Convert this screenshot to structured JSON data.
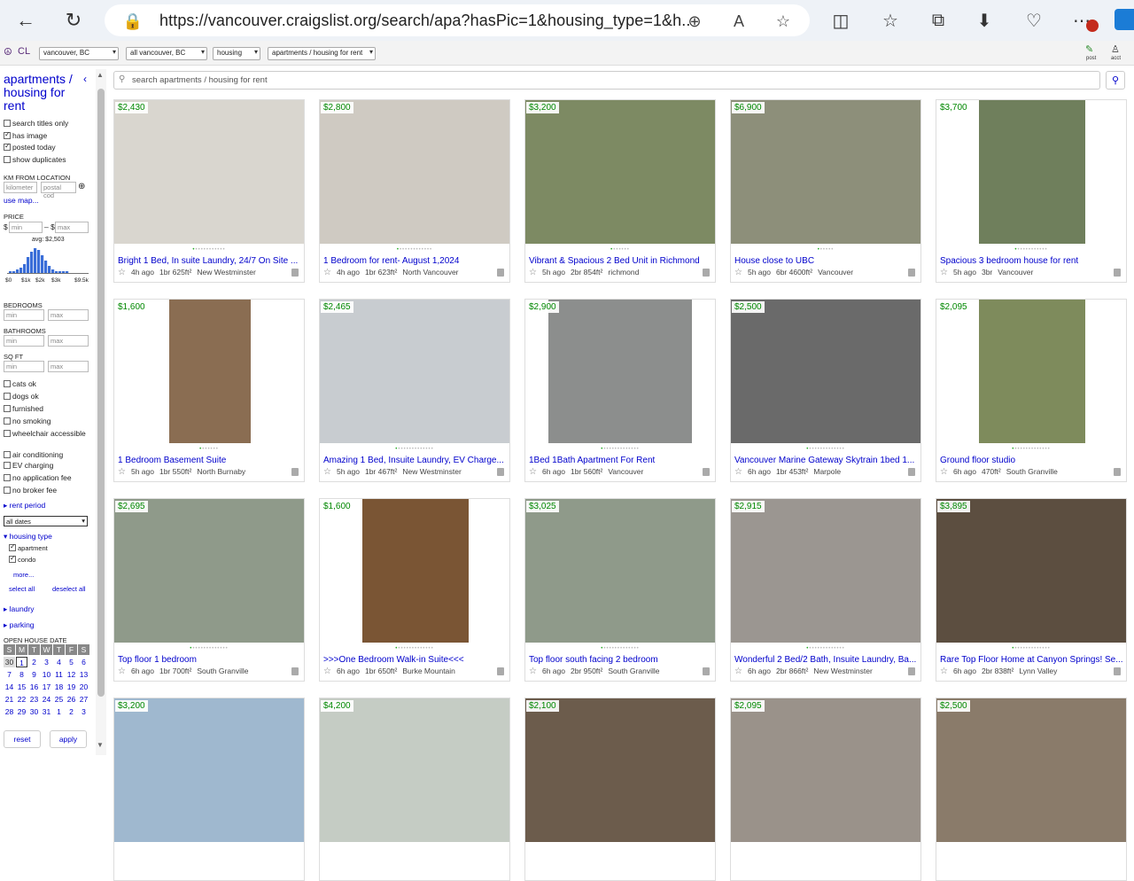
{
  "browser": {
    "url": "https://vancouver.craigslist.org/search/apa?hasPic=1&housing_type=1&h..."
  },
  "topbar": {
    "logo": "CL",
    "selects": [
      "vancouver, BC",
      "all vancouver, BC",
      "housing",
      "apartments / housing for rent"
    ],
    "post_label": "post",
    "acct_label": "acct"
  },
  "sidebar": {
    "title": "apartments / housing for rent",
    "options": [
      {
        "label": "search titles only",
        "checked": false
      },
      {
        "label": "has image",
        "checked": true
      },
      {
        "label": "posted today",
        "checked": true
      },
      {
        "label": "show duplicates",
        "checked": false
      }
    ],
    "km_label": "KM FROM LOCATION",
    "km_placeholder": "kilometer",
    "postal_placeholder": "postal cod",
    "use_map": "use map...",
    "price_label": "PRICE",
    "price_min": "min",
    "price_max": "max",
    "price_avg": "avg: $2,503",
    "hist_ticks": [
      "$0",
      "$1k",
      "$2k",
      "$3k",
      "$9.5k"
    ],
    "bedrooms_label": "BEDROOMS",
    "bathrooms_label": "BATHROOMS",
    "sqft_label": "SQ FT",
    "min": "min",
    "max": "max",
    "amenities": [
      {
        "label": "cats ok"
      },
      {
        "label": "dogs ok"
      },
      {
        "label": "furnished"
      },
      {
        "label": "no smoking"
      },
      {
        "label": "wheelchair accessible"
      },
      {
        "label": "air conditioning"
      },
      {
        "label": "EV charging"
      },
      {
        "label": "no application fee"
      },
      {
        "label": "no broker fee"
      }
    ],
    "rent_period": "rent period",
    "dates_select": "all dates",
    "housing_type": "housing type",
    "housing_options": [
      {
        "label": "apartment",
        "checked": true
      },
      {
        "label": "condo",
        "checked": true
      }
    ],
    "more": "more...",
    "select_all": "select all",
    "deselect_all": "deselect all",
    "laundry": "laundry",
    "parking": "parking",
    "open_house_label": "OPEN HOUSE DATE",
    "calendar_head": [
      "S",
      "M",
      "T",
      "W",
      "T",
      "F",
      "S"
    ],
    "calendar_rows": [
      [
        "30",
        "1",
        "2",
        "3",
        "4",
        "5",
        "6"
      ],
      [
        "7",
        "8",
        "9",
        "10",
        "11",
        "12",
        "13"
      ],
      [
        "14",
        "15",
        "16",
        "17",
        "18",
        "19",
        "20"
      ],
      [
        "21",
        "22",
        "23",
        "24",
        "25",
        "26",
        "27"
      ],
      [
        "28",
        "29",
        "30",
        "31",
        "1",
        "2",
        "3"
      ]
    ],
    "reset": "reset",
    "apply": "apply"
  },
  "search": {
    "placeholder": "search apartments / housing for rent"
  },
  "listings": [
    {
      "price": "$2,430",
      "title": "Bright 1 Bed, In suite Laundry, 24/7 On Site ...",
      "age": "4h ago",
      "size": "1br 625ft²",
      "loc": "New Westminster",
      "dots": 12,
      "active": 0,
      "color": "#d9d6cf"
    },
    {
      "price": "$2,800",
      "title": "1 Bedroom for rent- August 1,2024",
      "age": "4h ago",
      "size": "1br 623ft²",
      "loc": "North Vancouver",
      "dots": 13,
      "active": 0,
      "color": "#cfcac2"
    },
    {
      "price": "$3,200",
      "title": "Vibrant & Spacious 2 Bed Unit in Richmond",
      "age": "5h ago",
      "size": "2br 854ft²",
      "loc": "richmond",
      "dots": 7,
      "active": 0,
      "color": "#7d8a63"
    },
    {
      "price": "$6,900",
      "title": "House close to UBC",
      "age": "5h ago",
      "size": "6br 4600ft²",
      "loc": "Vancouver",
      "dots": 6,
      "active": 0,
      "color": "#8d8f7a"
    },
    {
      "price": "$3,700",
      "title": "Spacious 3 bedroom house for rent",
      "age": "5h ago",
      "size": "3br",
      "loc": "Vancouver",
      "dots": 12,
      "active": 0,
      "color": "#6f7f5c"
    },
    {
      "price": "$1,600",
      "title": "1 Bedroom Basement Suite",
      "age": "5h ago",
      "size": "1br 550ft²",
      "loc": "North Burnaby",
      "dots": 7,
      "active": 0,
      "color": "#8a6d52"
    },
    {
      "price": "$2,465",
      "title": "Amazing 1 Bed, Insuite Laundry, EV Charge...",
      "age": "5h ago",
      "size": "1br 467ft²",
      "loc": "New Westminster",
      "dots": 14,
      "active": 0,
      "color": "#c8ccd0"
    },
    {
      "price": "$2,900",
      "title": "1Bed 1Bath Apartment For Rent",
      "age": "6h ago",
      "size": "1br 560ft²",
      "loc": "Vancouver",
      "dots": 14,
      "active": 0,
      "color": "#8c8e8d"
    },
    {
      "price": "$2,500",
      "title": "Vancouver Marine Gateway Skytrain 1bed 1...",
      "age": "6h ago",
      "size": "1br 453ft²",
      "loc": "Marpole",
      "dots": 14,
      "active": 0,
      "color": "#6a6a6a"
    },
    {
      "price": "$2,095",
      "title": "Ground floor studio",
      "age": "6h ago",
      "size": "470ft²",
      "loc": "South Granville",
      "dots": 14,
      "active": 0,
      "color": "#7e8b5c"
    },
    {
      "price": "$2,695",
      "title": "Top floor 1 bedroom",
      "age": "6h ago",
      "size": "1br 700ft²",
      "loc": "South Granville",
      "dots": 14,
      "active": 0,
      "color": "#8f9a8a"
    },
    {
      "price": "$1,600",
      "title": ">>>One Bedroom Walk-in Suite<<<",
      "age": "6h ago",
      "size": "1br 650ft²",
      "loc": "Burke Mountain",
      "dots": 14,
      "active": 0,
      "color": "#7a5534"
    },
    {
      "price": "$3,025",
      "title": "Top floor south facing 2 bedroom",
      "age": "6h ago",
      "size": "2br 950ft²",
      "loc": "South Granville",
      "dots": 14,
      "active": 0,
      "color": "#8f9a8a"
    },
    {
      "price": "$2,915",
      "title": "Wonderful 2 Bed/2 Bath, Insuite Laundry, Ba...",
      "age": "6h ago",
      "size": "2br 866ft²",
      "loc": "New Westminster",
      "dots": 14,
      "active": 0,
      "color": "#9b9691"
    },
    {
      "price": "$3,895",
      "title": "Rare Top Floor Home at Canyon Springs! Se...",
      "age": "6h ago",
      "size": "2br 838ft²",
      "loc": "Lynn Valley",
      "dots": 14,
      "active": 0,
      "color": "#5c4e40"
    },
    {
      "price": "$3,200",
      "title": "",
      "age": "",
      "size": "",
      "loc": "",
      "dots": 0,
      "active": 0,
      "color": "#9fb8cf"
    },
    {
      "price": "$4,200",
      "title": "",
      "age": "",
      "size": "",
      "loc": "",
      "dots": 0,
      "active": 0,
      "color": "#c5ccc4"
    },
    {
      "price": "$2,100",
      "title": "",
      "age": "",
      "size": "",
      "loc": "",
      "dots": 0,
      "active": 0,
      "color": "#6c5c4c"
    },
    {
      "price": "$2,095",
      "title": "",
      "age": "",
      "size": "",
      "loc": "",
      "dots": 0,
      "active": 0,
      "color": "#9a928a"
    },
    {
      "price": "$2,500",
      "title": "",
      "age": "",
      "size": "",
      "loc": "",
      "dots": 0,
      "active": 0,
      "color": "#8a7b6a"
    }
  ],
  "colors": {
    "link": "#0000cc",
    "price": "#008800"
  }
}
